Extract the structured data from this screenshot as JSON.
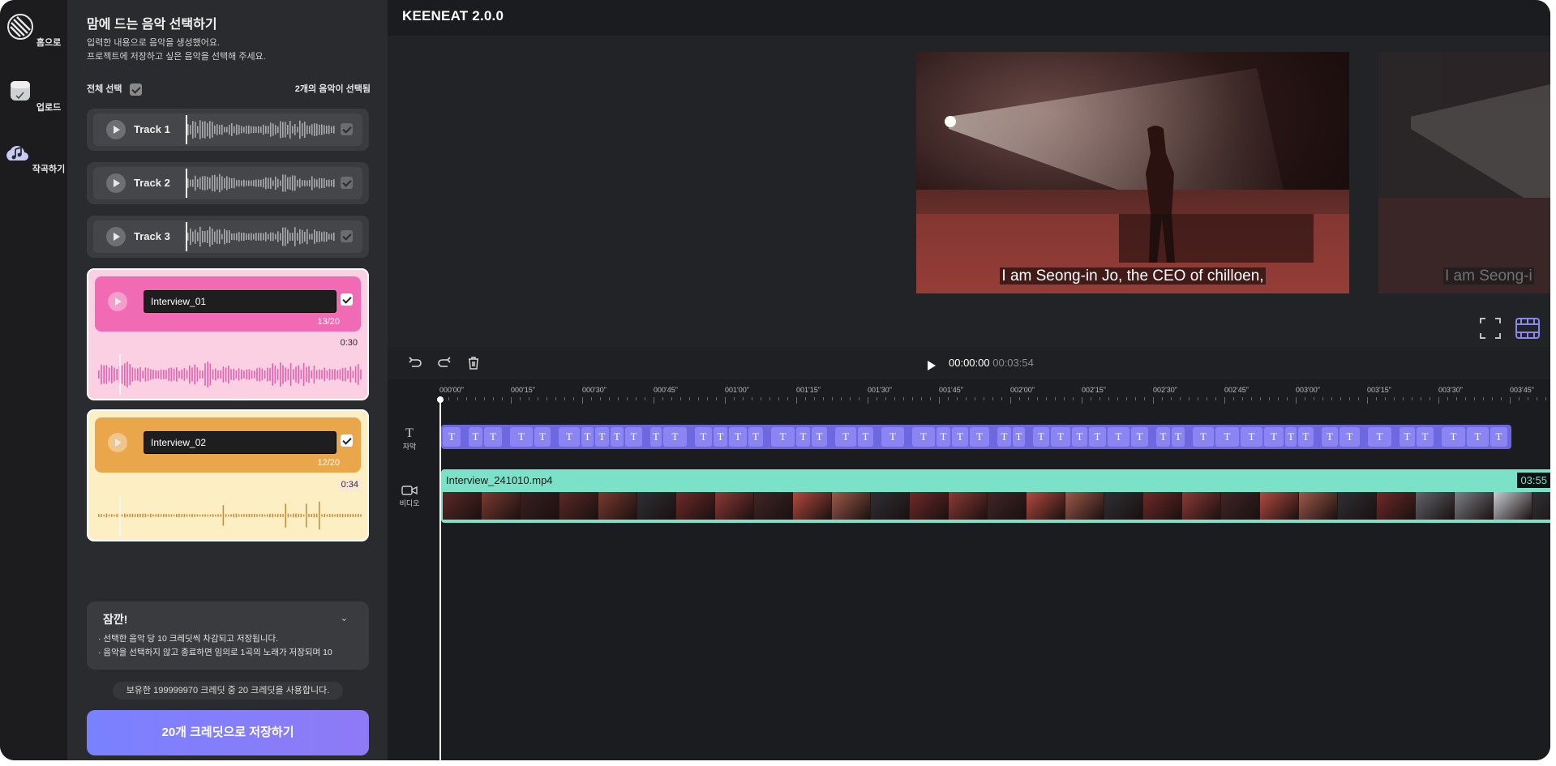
{
  "rail": {
    "items": [
      {
        "label": "홈으로"
      },
      {
        "label": "업로드"
      },
      {
        "label": "작곡하기"
      }
    ]
  },
  "panel": {
    "title": "맘에 드는 음악 선택하기",
    "desc_line1": "입력한 내용으로 음악을 생성했어요.",
    "desc_line2": "프로젝트에 저장하고 싶은 음악을 선택해 주세요.",
    "select_all": "전체 선택",
    "selected_count": "2개의 음악이 선택됨",
    "tracks": [
      {
        "name": "Track 1"
      },
      {
        "name": "Track 2"
      },
      {
        "name": "Track 3"
      }
    ],
    "cards": [
      {
        "value": "Interview_01",
        "counter": "13/20",
        "duration": "0:30",
        "accent": "#f06ab4",
        "bg": "#fbd0e3"
      },
      {
        "value": "Interview_02",
        "counter": "12/20",
        "duration": "0:34",
        "accent": "#e9a64a",
        "bg": "#fcefc3"
      }
    ],
    "notice": {
      "title": "잠깐!",
      "line1": "· 선택한 음악 당 10 크레딧씩 차감되고 저장됩니다.",
      "line2": "· 음악을 선택하지 않고 종료하면 임의로 1곡의 노래가 저장되며 10"
    },
    "credit_info": "보유한 199999970 크레딧 중 20 크레딧을 사용합니다.",
    "save_label": "20개 크레딧으로 저장하기"
  },
  "editor": {
    "app_title": "KEENEAT 2.0.0",
    "subtitle_text": "I am Seong-in Jo, the CEO of chilloen,",
    "subtitle_text_next": "I am Seong-i",
    "time_current": "00:00:00",
    "time_total": "00:03:54",
    "ruler_ticks": [
      "000'00\"",
      "000'15\"",
      "000'30\"",
      "000'45\"",
      "001'00\"",
      "001'15\"",
      "001'30\"",
      "001'45\"",
      "002'00\"",
      "002'15\"",
      "002'30\"",
      "002'45\"",
      "003'00\"",
      "003'15\"",
      "003'30\"",
      "003'45\""
    ],
    "label_subtitle": "자막",
    "label_video": "비디오",
    "video_clip_name": "Interview_241010.mp4",
    "video_clip_duration": "03:55"
  }
}
